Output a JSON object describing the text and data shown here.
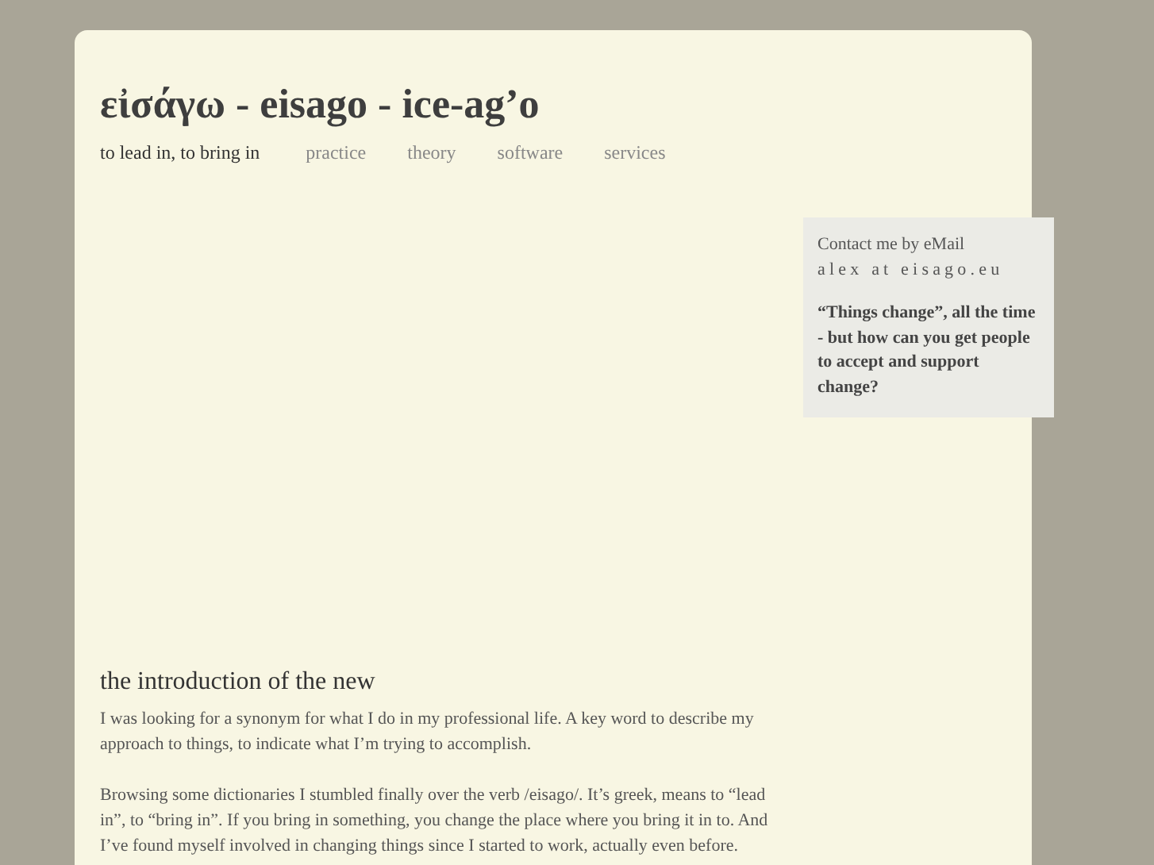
{
  "header": {
    "title": "εἰσάγω - eisago - ice-ag’o",
    "tagline": "to lead in, to bring in"
  },
  "nav": [
    "practice",
    "theory",
    "software",
    "services"
  ],
  "sidebar": {
    "contact_label": "Contact me by eMail",
    "email": "alex at eisago.eu",
    "quote": "“Things change”, all the time - but how can you get people to accept and support change?"
  },
  "article": {
    "heading": "the introduction of the new",
    "paragraphs": [
      "I was looking for a synonym for what I do in my professional life. A key word to describe my approach to things, to indicate what I’m trying to accomplish.",
      "Browsing some dictionaries I stumbled finally over the verb /eisago/. It’s greek, means to “lead in”, to “bring in”. If you bring in something, you change the place where you bring it in to. And I’ve found myself involved in changing things since I started to work, actually even before."
    ]
  }
}
